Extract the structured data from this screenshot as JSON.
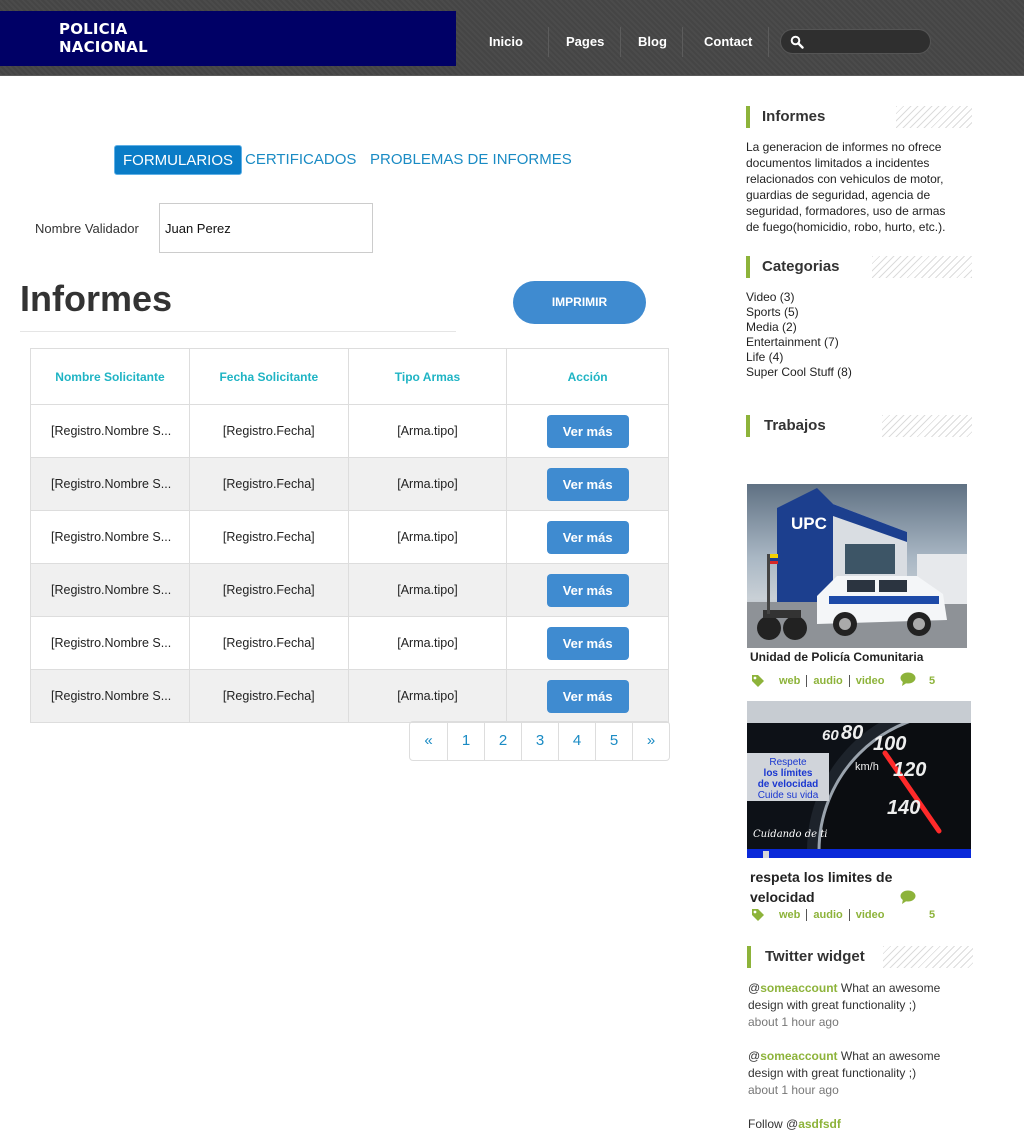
{
  "brand": {
    "line1": "POLICIA",
    "line2": "NACIONAL"
  },
  "nav": {
    "items": [
      "Inicio",
      "Pages",
      "Blog",
      "Contact"
    ],
    "search_placeholder": ""
  },
  "tabs": [
    "FORMULARIOS",
    "CERTIFICADOS",
    "PROBLEMAS DE INFORMES"
  ],
  "validator": {
    "label": "Nombre Validador",
    "value": "Juan Perez"
  },
  "main": {
    "title": "Informes",
    "print_label": "IMPRIMIR"
  },
  "table": {
    "headers": [
      "Nombre Solicitante",
      "Fecha Solicitante",
      "Tipo Armas",
      "Acción"
    ],
    "rows": [
      {
        "name": "[Registro.Nombre S...",
        "date": "[Registro.Fecha]",
        "type": "[Arma.tipo]",
        "action": "Ver más"
      },
      {
        "name": "[Registro.Nombre S...",
        "date": "[Registro.Fecha]",
        "type": "[Arma.tipo]",
        "action": "Ver más"
      },
      {
        "name": "[Registro.Nombre S...",
        "date": "[Registro.Fecha]",
        "type": "[Arma.tipo]",
        "action": "Ver más"
      },
      {
        "name": "[Registro.Nombre S...",
        "date": "[Registro.Fecha]",
        "type": "[Arma.tipo]",
        "action": "Ver más"
      },
      {
        "name": "[Registro.Nombre S...",
        "date": "[Registro.Fecha]",
        "type": "[Arma.tipo]",
        "action": "Ver más"
      },
      {
        "name": "[Registro.Nombre S...",
        "date": "[Registro.Fecha]",
        "type": "[Arma.tipo]",
        "action": "Ver más"
      }
    ]
  },
  "pager": [
    "«",
    "1",
    "2",
    "3",
    "4",
    "5",
    "»"
  ],
  "sidebar": {
    "informes": {
      "title": "Informes",
      "text": "La generacion de informes no ofrece documentos limitados a incidentes relacionados con vehiculos de motor, guardias de seguridad, agencia de seguridad, formadores, uso de armas de fuego(homicidio, robo, hurto, etc.)."
    },
    "categorias": {
      "title": "Categorias",
      "items": [
        "Video (3)",
        "Sports (5)",
        "Media (2)",
        "Entertainment (7)",
        "Life (4)",
        "Super Cool Stuff (8)"
      ]
    },
    "trabajos": {
      "title": "Trabajos",
      "items": [
        {
          "title": "Unidad de Policía Comunitaria",
          "tags": [
            "web",
            "audio",
            "video"
          ],
          "comments": "5",
          "img_text": "UPC"
        },
        {
          "title": "respeta los limites de velocidad",
          "tags": [
            "web",
            "audio",
            "video"
          ],
          "comments": "5",
          "img_lines": [
            "Respete",
            "los límites",
            "de velocidad",
            "Cuide su vida"
          ],
          "img_caption": "Cuidando de ti",
          "dial": [
            "60",
            "80",
            "100",
            "120",
            "140"
          ],
          "unit": "km/h"
        }
      ]
    },
    "twitter": {
      "title": "Twitter widget",
      "tweets": [
        {
          "at": "@",
          "account": "someaccount",
          "text": " What an awesome design with great functionality ;)",
          "time": "about 1 hour ago"
        },
        {
          "at": "@",
          "account": "someaccount",
          "text": " What an awesome design with great functionality ;)",
          "time": "about 1 hour ago"
        }
      ],
      "follow_prefix": "Follow @",
      "follow_account": "asdfsdf"
    }
  },
  "colors": {
    "brand_bg": "#000066",
    "accent_blue": "#3f8bd0",
    "link_blue": "#1a8bc4",
    "accent_green": "#8db33a",
    "header_teal": "#1fb4c4"
  }
}
